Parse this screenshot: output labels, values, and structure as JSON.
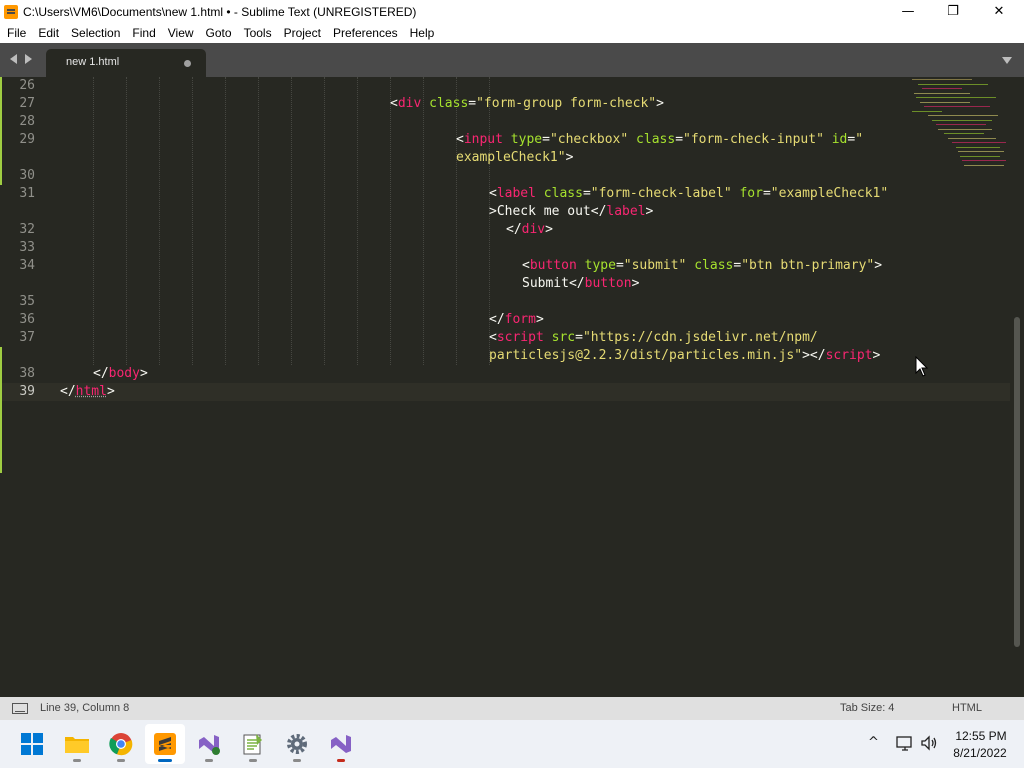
{
  "window": {
    "title": "C:\\Users\\VM6\\Documents\\new 1.html • - Sublime Text (UNREGISTERED)",
    "minimize_glyph": "—",
    "maximize_glyph": "❐",
    "close_glyph": "✕"
  },
  "menu": [
    "File",
    "Edit",
    "Selection",
    "Find",
    "View",
    "Goto",
    "Tools",
    "Project",
    "Preferences",
    "Help"
  ],
  "tabs": [
    {
      "label": "new 1.html",
      "dirty": true,
      "active": true
    }
  ],
  "editor": {
    "lines": [
      {
        "n": "26",
        "tokens": []
      },
      {
        "n": "27",
        "tokens": [
          [
            "p",
            "<"
          ],
          [
            "t",
            "div"
          ],
          [
            "a",
            " class"
          ],
          [
            "p",
            "="
          ],
          [
            "s",
            "\"form-group form-check\""
          ],
          [
            "p",
            ">"
          ]
        ]
      },
      {
        "n": "28",
        "tokens": []
      },
      {
        "n": "29",
        "tokens": [
          [
            "p",
            "<"
          ],
          [
            "t",
            "input"
          ],
          [
            "a",
            " type"
          ],
          [
            "p",
            "="
          ],
          [
            "s",
            "\"checkbox\""
          ],
          [
            "a",
            " class"
          ],
          [
            "p",
            "="
          ],
          [
            "s",
            "\"form-check-input\""
          ],
          [
            "a",
            " id"
          ],
          [
            "p",
            "="
          ],
          [
            "s",
            "\""
          ]
        ]
      },
      {
        "n": "",
        "tokens": [
          [
            "s",
            "exampleCheck1\""
          ],
          [
            "p",
            ">"
          ]
        ]
      },
      {
        "n": "30",
        "tokens": []
      },
      {
        "n": "31",
        "tokens": [
          [
            "p",
            "<"
          ],
          [
            "t",
            "label"
          ],
          [
            "a",
            " class"
          ],
          [
            "p",
            "="
          ],
          [
            "s",
            "\"form-check-label\""
          ],
          [
            "a",
            " for"
          ],
          [
            "p",
            "="
          ],
          [
            "s",
            "\"exampleCheck1\""
          ]
        ]
      },
      {
        "n": "",
        "tokens": [
          [
            "p",
            ">"
          ],
          [
            "x",
            "Check me out"
          ],
          [
            "p",
            "</"
          ],
          [
            "t",
            "label"
          ],
          [
            "p",
            ">"
          ]
        ]
      },
      {
        "n": "32",
        "tokens": [
          [
            "p",
            "</"
          ],
          [
            "t",
            "div"
          ],
          [
            "p",
            ">"
          ]
        ]
      },
      {
        "n": "33",
        "tokens": []
      },
      {
        "n": "34",
        "tokens": [
          [
            "p",
            "<"
          ],
          [
            "t",
            "button"
          ],
          [
            "a",
            " type"
          ],
          [
            "p",
            "="
          ],
          [
            "s",
            "\"submit\""
          ],
          [
            "a",
            " class"
          ],
          [
            "p",
            "="
          ],
          [
            "s",
            "\"btn btn-primary\""
          ],
          [
            "p",
            ">"
          ]
        ]
      },
      {
        "n": "",
        "tokens": [
          [
            "x",
            "Submit"
          ],
          [
            "p",
            "</"
          ],
          [
            "t",
            "button"
          ],
          [
            "p",
            ">"
          ]
        ]
      },
      {
        "n": "35",
        "tokens": []
      },
      {
        "n": "36",
        "tokens": [
          [
            "p",
            "</"
          ],
          [
            "t",
            "form"
          ],
          [
            "p",
            ">"
          ]
        ]
      },
      {
        "n": "37",
        "tokens": [
          [
            "p",
            "<"
          ],
          [
            "t",
            "script"
          ],
          [
            "a",
            " src"
          ],
          [
            "p",
            "="
          ],
          [
            "s",
            "\"https://cdn.jsdelivr.net/npm/"
          ]
        ]
      },
      {
        "n": "",
        "tokens": [
          [
            "s",
            "particlesjs@2.2.3/dist/particles.min.js\""
          ],
          [
            "p",
            "></"
          ],
          [
            "t",
            "script"
          ],
          [
            "p",
            ">"
          ]
        ]
      },
      {
        "n": "38",
        "tokens": [
          [
            "p",
            "</"
          ],
          [
            "t",
            "body"
          ],
          [
            "p",
            ">"
          ]
        ]
      },
      {
        "n": "39",
        "tokens": [
          [
            "p",
            "</"
          ],
          [
            "u",
            "html"
          ],
          [
            "p",
            ">"
          ]
        ]
      }
    ]
  },
  "status": {
    "position": "Line 39, Column 8",
    "tab_size": "Tab Size: 4",
    "syntax": "HTML"
  },
  "taskbar": {
    "apps": [
      {
        "name": "start",
        "color": "#0078d4"
      },
      {
        "name": "file-explorer",
        "color": "#f4b400"
      },
      {
        "name": "chrome",
        "color": "#db4437"
      },
      {
        "name": "sublime-text",
        "color": "#ff9800"
      },
      {
        "name": "visual-studio-preview",
        "color": "#8661c5"
      },
      {
        "name": "notepad-plus-plus",
        "color": "#7cb342"
      },
      {
        "name": "settings",
        "color": "#5f6b7a"
      },
      {
        "name": "visual-studio",
        "color": "#8661c5"
      }
    ],
    "tray_chevron": "^",
    "clock_time": "12:55 PM",
    "clock_date": "8/21/2022"
  }
}
